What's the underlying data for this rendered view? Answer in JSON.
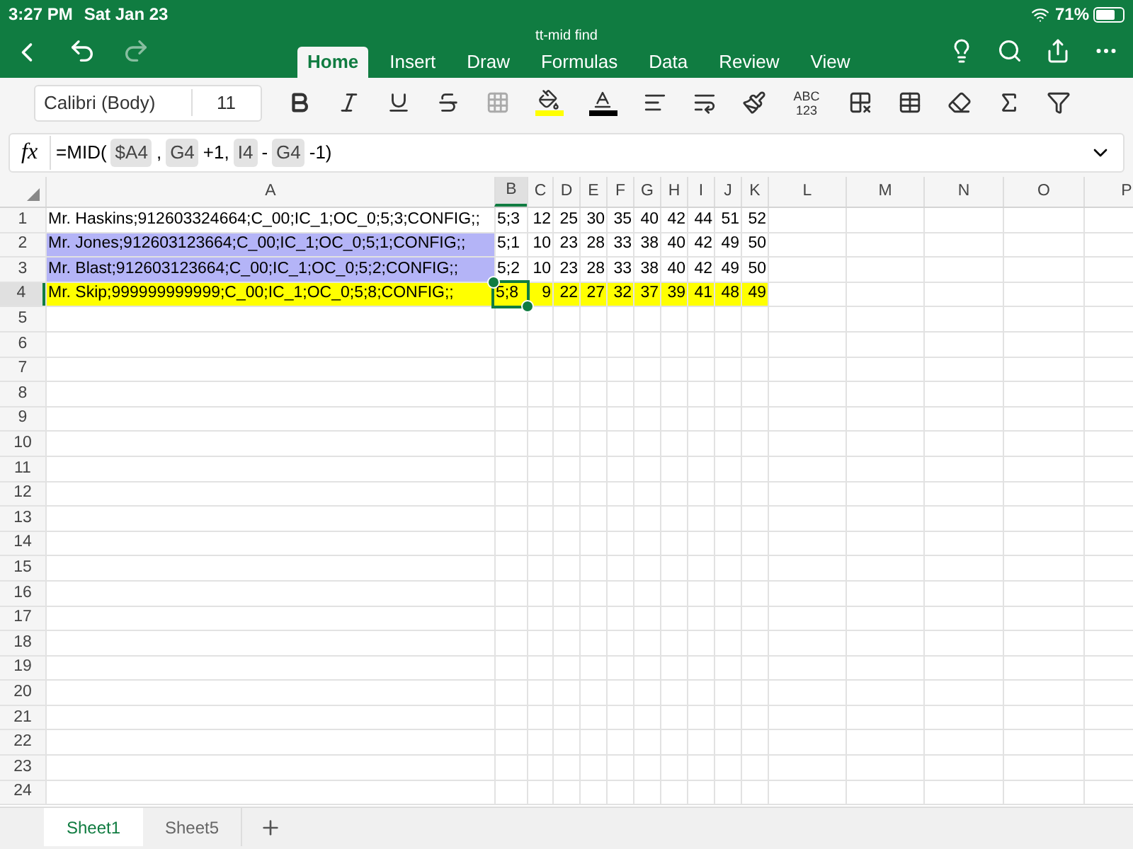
{
  "status_bar": {
    "time": "3:27 PM",
    "date": "Sat Jan 23",
    "battery": "71%"
  },
  "window": {
    "title": "tt-mid find"
  },
  "tabs": [
    {
      "label": "Home",
      "selected": true
    },
    {
      "label": "Insert",
      "selected": false
    },
    {
      "label": "Draw",
      "selected": false
    },
    {
      "label": "Formulas",
      "selected": false
    },
    {
      "label": "Data",
      "selected": false
    },
    {
      "label": "Review",
      "selected": false
    },
    {
      "label": "View",
      "selected": false
    }
  ],
  "toolbar": {
    "font": "Calibri (Body)",
    "size": "11",
    "sum_label": "ABC 123"
  },
  "formula_bar": {
    "icon": "fx",
    "parts": [
      {
        "kind": "plain",
        "text": "=MID("
      },
      {
        "kind": "ref",
        "text": "$A4"
      },
      {
        "kind": "plain",
        "text": ","
      },
      {
        "kind": "ref",
        "text": "G4"
      },
      {
        "kind": "plain",
        "text": "+1,"
      },
      {
        "kind": "ref",
        "text": "I4"
      },
      {
        "kind": "plain",
        "text": "-"
      },
      {
        "kind": "ref",
        "text": "G4"
      },
      {
        "kind": "plain",
        "text": "-1)"
      }
    ]
  },
  "columns": [
    {
      "label": "A",
      "selected": false
    },
    {
      "label": "B",
      "selected": true
    },
    {
      "label": "C",
      "selected": false
    },
    {
      "label": "D",
      "selected": false
    },
    {
      "label": "E",
      "selected": false
    },
    {
      "label": "F",
      "selected": false
    },
    {
      "label": "G",
      "selected": false
    },
    {
      "label": "H",
      "selected": false
    },
    {
      "label": "I",
      "selected": false
    },
    {
      "label": "J",
      "selected": false
    },
    {
      "label": "K",
      "selected": false
    },
    {
      "label": "L",
      "selected": false
    },
    {
      "label": "M",
      "selected": false
    },
    {
      "label": "N",
      "selected": false
    },
    {
      "label": "O",
      "selected": false
    },
    {
      "label": "P",
      "selected": false
    }
  ],
  "rows": [
    {
      "number": "1",
      "selected": false,
      "cells": [
        {
          "text": "Mr. Haskins;912603324664;C_00;IC_1;OC_0;5;3;CONFIG;;"
        },
        {
          "text": "5;3"
        },
        {
          "text": "12"
        },
        {
          "text": "25"
        },
        {
          "text": "30"
        },
        {
          "text": "35"
        },
        {
          "text": "40"
        },
        {
          "text": "42"
        },
        {
          "text": "44"
        },
        {
          "text": "51"
        },
        {
          "text": "52"
        }
      ]
    },
    {
      "number": "2",
      "selected": false,
      "cells": [
        {
          "text": "Mr. Jones;912603123664;C_00;IC_1;OC_0;5;1;CONFIG;;",
          "color": "#b4b4f7"
        },
        {
          "text": "5;1"
        },
        {
          "text": "10"
        },
        {
          "text": "23"
        },
        {
          "text": "28"
        },
        {
          "text": "33"
        },
        {
          "text": "38"
        },
        {
          "text": "40"
        },
        {
          "text": "42"
        },
        {
          "text": "49"
        },
        {
          "text": "50"
        }
      ]
    },
    {
      "number": "3",
      "selected": false,
      "cells": [
        {
          "text": "Mr. Blast;912603123664;C_00;IC_1;OC_0;5;2;CONFIG;;",
          "color": "#b4b4f7"
        },
        {
          "text": "5;2"
        },
        {
          "text": "10"
        },
        {
          "text": "23"
        },
        {
          "text": "28"
        },
        {
          "text": "33"
        },
        {
          "text": "38"
        },
        {
          "text": "40"
        },
        {
          "text": "42"
        },
        {
          "text": "49"
        },
        {
          "text": "50"
        }
      ]
    },
    {
      "number": "4",
      "selected": true,
      "cells": [
        {
          "text": "Mr. Skip;999999999999;C_00;IC_1;OC_0;5;8;CONFIG;;",
          "color": "#ffff00"
        },
        {
          "text": "5;8",
          "color": "#ffff00",
          "selected": true
        },
        {
          "text": "9",
          "color": "#ffff00"
        },
        {
          "text": "22",
          "color": "#ffff00"
        },
        {
          "text": "27",
          "color": "#ffff00"
        },
        {
          "text": "32",
          "color": "#ffff00"
        },
        {
          "text": "37",
          "color": "#ffff00"
        },
        {
          "text": "39",
          "color": "#ffff00"
        },
        {
          "text": "41",
          "color": "#ffff00"
        },
        {
          "text": "48",
          "color": "#ffff00"
        },
        {
          "text": "49",
          "color": "#ffff00"
        }
      ]
    },
    {
      "number": "5",
      "selected": false
    },
    {
      "number": "6",
      "selected": false
    },
    {
      "number": "7",
      "selected": false
    },
    {
      "number": "8",
      "selected": false
    },
    {
      "number": "9",
      "selected": false
    },
    {
      "number": "10",
      "selected": false
    },
    {
      "number": "11",
      "selected": false
    },
    {
      "number": "12",
      "selected": false
    },
    {
      "number": "13",
      "selected": false
    },
    {
      "number": "14",
      "selected": false
    },
    {
      "number": "15",
      "selected": false
    },
    {
      "number": "16",
      "selected": false
    },
    {
      "number": "17",
      "selected": false
    },
    {
      "number": "18",
      "selected": false
    },
    {
      "number": "19",
      "selected": false
    },
    {
      "number": "20",
      "selected": false
    },
    {
      "number": "21",
      "selected": false
    },
    {
      "number": "22",
      "selected": false
    },
    {
      "number": "23",
      "selected": false
    },
    {
      "number": "24",
      "selected": false
    }
  ],
  "sheets": [
    {
      "label": "Sheet1",
      "selected": true
    },
    {
      "label": "Sheet5",
      "selected": false
    }
  ]
}
